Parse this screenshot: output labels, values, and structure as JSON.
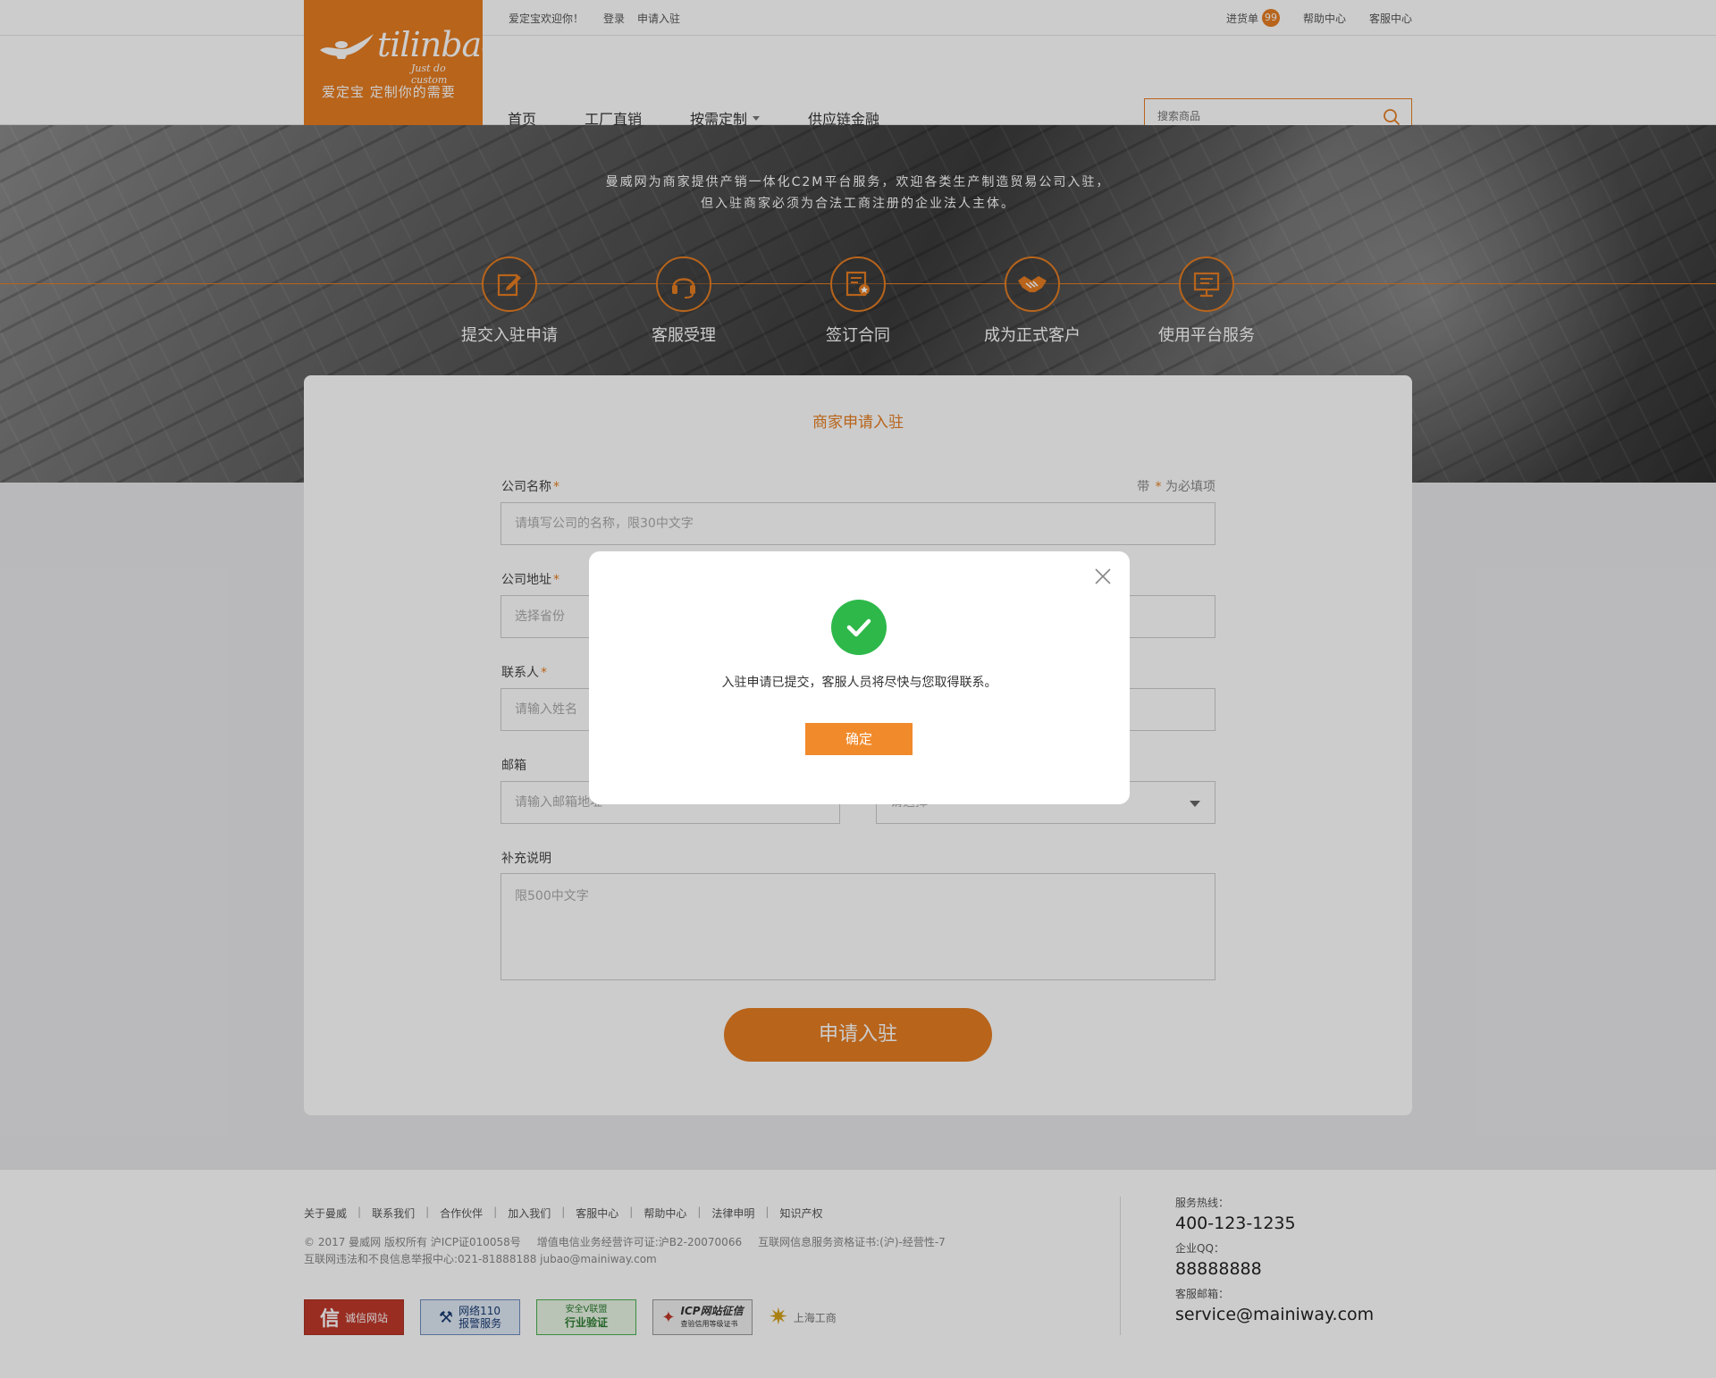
{
  "header": {
    "welcome": "爱定宝欢迎你！",
    "login": "登录",
    "apply": "申请入驻",
    "cart_label": "进货单",
    "cart_count": "99",
    "help": "帮助中心",
    "service": "客服中心",
    "logo_text": "tilinbao",
    "logo_tagline": "Just do custom",
    "logo_slogan": "爱定宝   定制你的需要",
    "nav": [
      "首页",
      "工厂直销",
      "按需定制",
      "供应链金融"
    ],
    "search_placeholder": "搜索商品"
  },
  "hero": {
    "line1": "曼威网为商家提供产销一体化C2M平台服务，欢迎各类生产制造贸易公司入驻，",
    "line2": "但入驻商家必须为合法工商注册的企业法人主体。",
    "steps": [
      "提交入驻申请",
      "客服受理",
      "签订合同",
      "成为正式客户",
      "使用平台服务"
    ]
  },
  "form": {
    "title": "商家申请入驻",
    "required_note_pre": "带",
    "required_note_star": "*",
    "required_note_post": "为必填项",
    "company_name_label": "公司名称",
    "company_name_placeholder": "请填写公司的名称，限30中文字",
    "address_label": "公司地址",
    "province_placeholder": "选择省份",
    "contact_label": "联系人",
    "contact_placeholder": "请输入姓名",
    "email_label": "邮箱",
    "email_placeholder": "请输入邮箱地址",
    "right_select_placeholder": "请选择",
    "remark_label": "补充说明",
    "remark_placeholder": "限500中文字",
    "submit": "申请入驻"
  },
  "footer": {
    "links": [
      "关于曼威",
      "联系我们",
      "合作伙伴",
      "加入我们",
      "客服中心",
      "帮助中心",
      "法律申明",
      "知识产权"
    ],
    "copyright": "© 2017 曼威网 版权所有 沪ICP证010058号",
    "license1": "增值电信业务经营许可证:沪B2-20070066",
    "license2": "互联网信息服务资格证书:(沪)-经营性-7",
    "report": "互联网违法和不良信息举报中心:021-81888188 jubao@mainiway.com",
    "badges": {
      "b1": "诚信网站",
      "b2_line1": "网络110",
      "b2_line2": "报警服务",
      "b3_top": "安全V联盟",
      "b3_main": "行业验证",
      "b4_main": "ICP网站征信",
      "b4_sub": "查验信用等级证书",
      "b5": "上海工商"
    },
    "hotline_label": "服务热线：",
    "hotline": "400-123-1235",
    "qq_label": "企业QQ：",
    "qq": "88888888",
    "mail_label": "客服邮箱：",
    "mail": "service@mainiway.com"
  },
  "modal": {
    "message": "入驻申请已提交，客服人员将尽快与您取得联系。",
    "confirm": "确定"
  },
  "colors": {
    "brand_orange": "#e67e22",
    "success_green": "#2eb84a"
  }
}
